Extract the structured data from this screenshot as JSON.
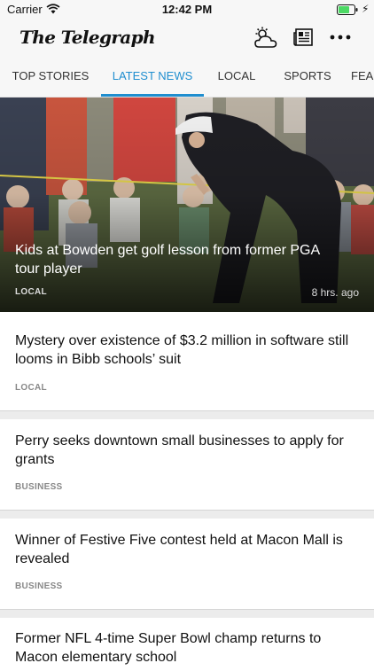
{
  "status_bar": {
    "carrier": "Carrier",
    "time": "12:42 PM"
  },
  "app": {
    "logo": "The Telegraph",
    "icons": [
      "weather-icon",
      "news-icon",
      "more-icon"
    ]
  },
  "tabs": [
    {
      "label": "TOP STORIES",
      "active": false
    },
    {
      "label": "LATEST NEWS",
      "active": true
    },
    {
      "label": "LOCAL",
      "active": false
    },
    {
      "label": "SPORTS",
      "active": false
    },
    {
      "label": "FEA",
      "active": false
    }
  ],
  "hero": {
    "title": "Kids at Bowden get golf lesson from former PGA tour player",
    "category": "LOCAL",
    "time": "8 hrs. ago"
  },
  "articles": [
    {
      "title": "Mystery over existence of $3.2 million in software still looms in Bibb schools’ suit",
      "category": "LOCAL"
    },
    {
      "title": "Perry seeks downtown small businesses to apply for grants",
      "category": "BUSINESS"
    },
    {
      "title": "Winner of Festive Five contest held at Macon Mall is revealed",
      "category": "BUSINESS"
    },
    {
      "title": "Former NFL 4-time Super Bowl champ returns to Macon elementary school",
      "category": ""
    }
  ],
  "colors": {
    "accent": "#1f8ecf",
    "background": "#ffffff",
    "bar": "#f7f7f7"
  }
}
